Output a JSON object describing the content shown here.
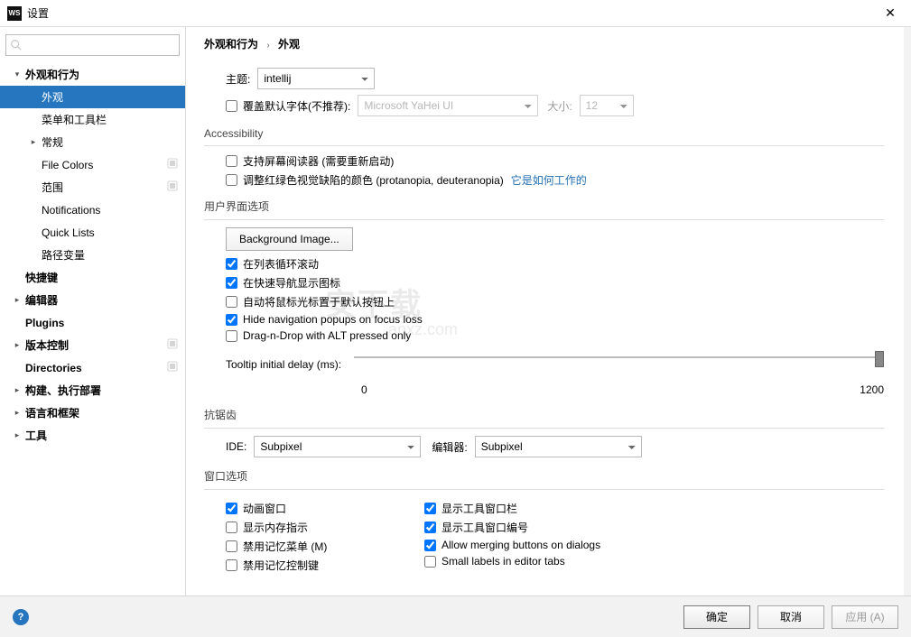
{
  "title": "设置",
  "sidebar": {
    "search_placeholder": "",
    "items": [
      {
        "label": "外观和行为",
        "indent": 0,
        "exp": "down",
        "bold": true,
        "sel": false,
        "proj": false
      },
      {
        "label": "外观",
        "indent": 1,
        "exp": "",
        "bold": false,
        "sel": true,
        "proj": false
      },
      {
        "label": "菜单和工具栏",
        "indent": 1,
        "exp": "",
        "bold": false,
        "sel": false,
        "proj": false
      },
      {
        "label": "常规",
        "indent": 1,
        "exp": "right",
        "bold": false,
        "sel": false,
        "proj": false
      },
      {
        "label": "File Colors",
        "indent": 1,
        "exp": "",
        "bold": false,
        "sel": false,
        "proj": true
      },
      {
        "label": "范围",
        "indent": 1,
        "exp": "",
        "bold": false,
        "sel": false,
        "proj": true
      },
      {
        "label": "Notifications",
        "indent": 1,
        "exp": "",
        "bold": false,
        "sel": false,
        "proj": false
      },
      {
        "label": "Quick Lists",
        "indent": 1,
        "exp": "",
        "bold": false,
        "sel": false,
        "proj": false
      },
      {
        "label": "路径变量",
        "indent": 1,
        "exp": "",
        "bold": false,
        "sel": false,
        "proj": false
      },
      {
        "label": "快捷键",
        "indent": 0,
        "exp": "",
        "bold": true,
        "sel": false,
        "proj": false
      },
      {
        "label": "编辑器",
        "indent": 0,
        "exp": "right",
        "bold": true,
        "sel": false,
        "proj": false
      },
      {
        "label": "Plugins",
        "indent": 0,
        "exp": "",
        "bold": true,
        "sel": false,
        "proj": false
      },
      {
        "label": "版本控制",
        "indent": 0,
        "exp": "right",
        "bold": true,
        "sel": false,
        "proj": true
      },
      {
        "label": "Directories",
        "indent": 0,
        "exp": "",
        "bold": true,
        "sel": false,
        "proj": true
      },
      {
        "label": "构建、执行部署",
        "indent": 0,
        "exp": "right",
        "bold": true,
        "sel": false,
        "proj": false
      },
      {
        "label": "语言和框架",
        "indent": 0,
        "exp": "right",
        "bold": true,
        "sel": false,
        "proj": false
      },
      {
        "label": "工具",
        "indent": 0,
        "exp": "right",
        "bold": true,
        "sel": false,
        "proj": false
      }
    ]
  },
  "breadcrumb": {
    "root": "外观和行为",
    "leaf": "外观"
  },
  "theme": {
    "label": "主题:",
    "value": "intellij"
  },
  "override_font": {
    "label": "覆盖默认字体(不推荐):",
    "font": "Microsoft YaHei UI",
    "size_label": "大小:",
    "size": "12"
  },
  "accessibility": {
    "title": "Accessibility",
    "screen_reader": "支持屏幕阅读器 (需要重新启动)",
    "color_deficiency": "调整红绿色视觉缺陷的颜色 (protanopia, deuteranopia)",
    "link": "它是如何工作的"
  },
  "ui_options": {
    "title": "用户界面选项",
    "bg_image": "Background Image...",
    "cyclic": "在列表循环滚动",
    "quick_nav": "在快速导航显示图标",
    "mouse_default": "自动将鼠标光标置于默认按钮上",
    "hide_popups": "Hide navigation popups on focus loss",
    "dnd_alt": "Drag-n-Drop with ALT pressed only",
    "tooltip_label": "Tooltip initial delay (ms):",
    "slider_min": "0",
    "slider_max": "1200"
  },
  "antialias": {
    "title": "抗锯齿",
    "ide_label": "IDE:",
    "ide_value": "Subpixel",
    "editor_label": "编辑器:",
    "editor_value": "Subpixel"
  },
  "window_opts": {
    "title": "窗口选项",
    "animate": "动画窗口",
    "memory": "显示内存指示",
    "disable_menu": "禁用记忆菜单 (M)",
    "disable_ctrl": "禁用记忆控制键",
    "show_toolbars": "显示工具窗口栏",
    "show_numbers": "显示工具窗口编号",
    "merge_buttons": "Allow merging buttons on dialogs",
    "small_labels": "Small labels in editor tabs"
  },
  "footer": {
    "ok": "确定",
    "cancel": "取消",
    "apply": "应用 (A)"
  }
}
